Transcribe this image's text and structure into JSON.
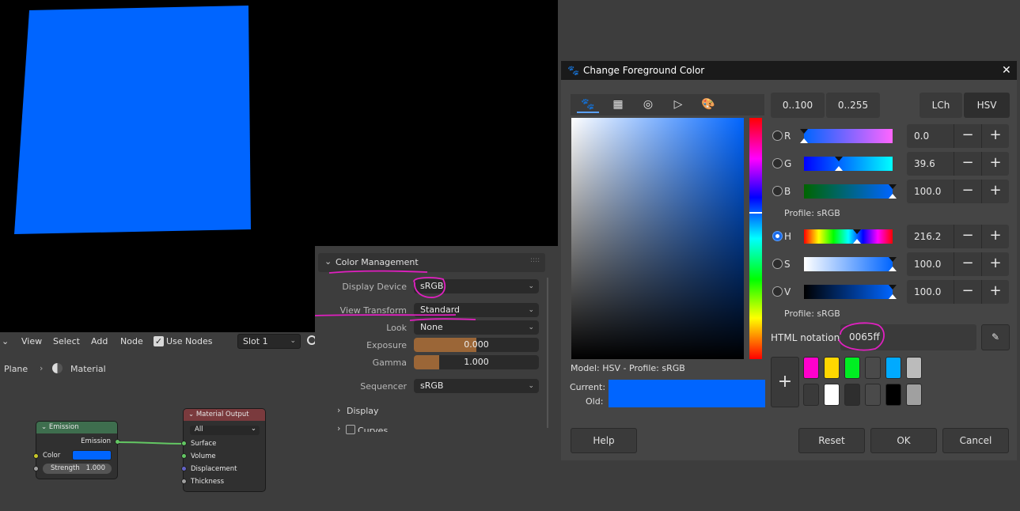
{
  "viewport": {
    "plane_color": "#0065ff"
  },
  "node_editor": {
    "menu": [
      "View",
      "Select",
      "Add",
      "Node"
    ],
    "use_nodes_label": "Use Nodes",
    "slot_value": "Slot 1",
    "breadcrumb": {
      "object": "Plane",
      "material": "Material"
    },
    "emission_node": {
      "title": "Emission",
      "output": "Emission",
      "color_label": "Color",
      "color_value": "#0065ff",
      "strength_label": "Strength",
      "strength_value": "1.000"
    },
    "output_node": {
      "title": "Material Output",
      "target": "All",
      "inputs": [
        "Surface",
        "Volume",
        "Displacement",
        "Thickness"
      ]
    }
  },
  "color_management": {
    "title": "Color Management",
    "display_device_label": "Display Device",
    "display_device": "sRGB",
    "view_transform_label": "View Transform",
    "view_transform": "Standard",
    "look_label": "Look",
    "look": "None",
    "exposure_label": "Exposure",
    "exposure": "0.000",
    "exposure_fill": 0.5,
    "gamma_label": "Gamma",
    "gamma": "1.000",
    "gamma_fill": 0.2,
    "sequencer_label": "Sequencer",
    "sequencer": "sRGB",
    "display_section": "Display",
    "curves_section": "Curves"
  },
  "dialog": {
    "title": "Change Foreground Color",
    "close": "✕",
    "scale_buttons": [
      "0..100",
      "0..255"
    ],
    "model_buttons": [
      "LCh",
      "HSV"
    ],
    "channels_rgb": [
      {
        "label": "R",
        "value": "0.0"
      },
      {
        "label": "G",
        "value": "39.6"
      },
      {
        "label": "B",
        "value": "100.0"
      }
    ],
    "channels_hsv": [
      {
        "label": "H",
        "value": "216.2"
      },
      {
        "label": "S",
        "value": "100.0"
      },
      {
        "label": "V",
        "value": "100.0"
      }
    ],
    "profile_rgb": "Profile: sRGB",
    "profile_hsv": "Profile: sRGB",
    "html_notation_label": "HTML notation:",
    "html_notation_value": "0065ff",
    "model_caption": "Model: HSV - Profile: sRGB",
    "current_label": "Current:",
    "old_label": "Old:",
    "current_color": "#0065ff",
    "history_colors_top": [
      "#ff00cc",
      "#ffd700",
      "#00ee22",
      "#4a4a4a",
      "#00aaff",
      "#bbbbbb"
    ],
    "history_colors_bottom": [
      "#3a3a3a",
      "#ffffff",
      "#2e2e2e",
      "#4a4a4a",
      "#000000",
      "#a0a0a0"
    ],
    "buttons": {
      "help": "Help",
      "reset": "Reset",
      "ok": "OK",
      "cancel": "Cancel"
    }
  }
}
